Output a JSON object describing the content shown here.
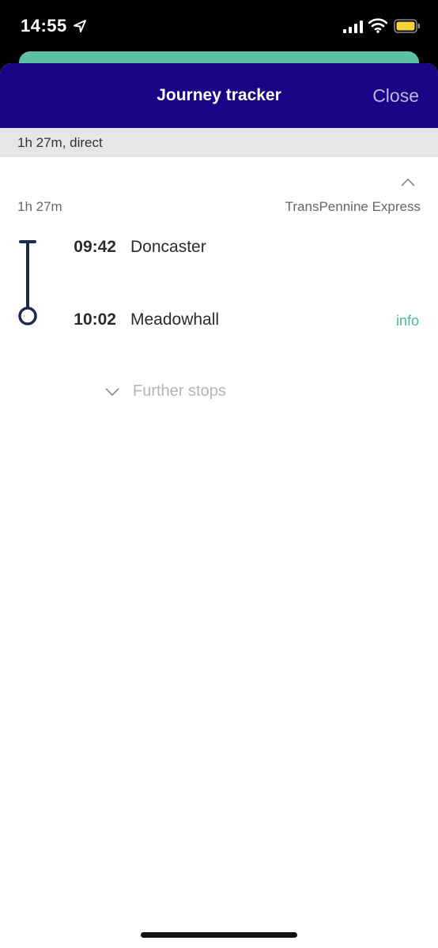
{
  "status_bar": {
    "time": "14:55"
  },
  "header": {
    "title": "Journey tracker",
    "close_label": "Close"
  },
  "summary": {
    "text": "1h 27m, direct"
  },
  "journey": {
    "duration": "1h 27m",
    "operator": "TransPennine Express",
    "stops": [
      {
        "time": "09:42",
        "name": "Doncaster"
      },
      {
        "time": "10:02",
        "name": "Meadowhall",
        "info_label": "info"
      }
    ],
    "further_stops_label": "Further stops"
  },
  "colors": {
    "header_bg": "#1b0386",
    "accent": "#4db8a0",
    "route_line": "#1e2a4a"
  }
}
